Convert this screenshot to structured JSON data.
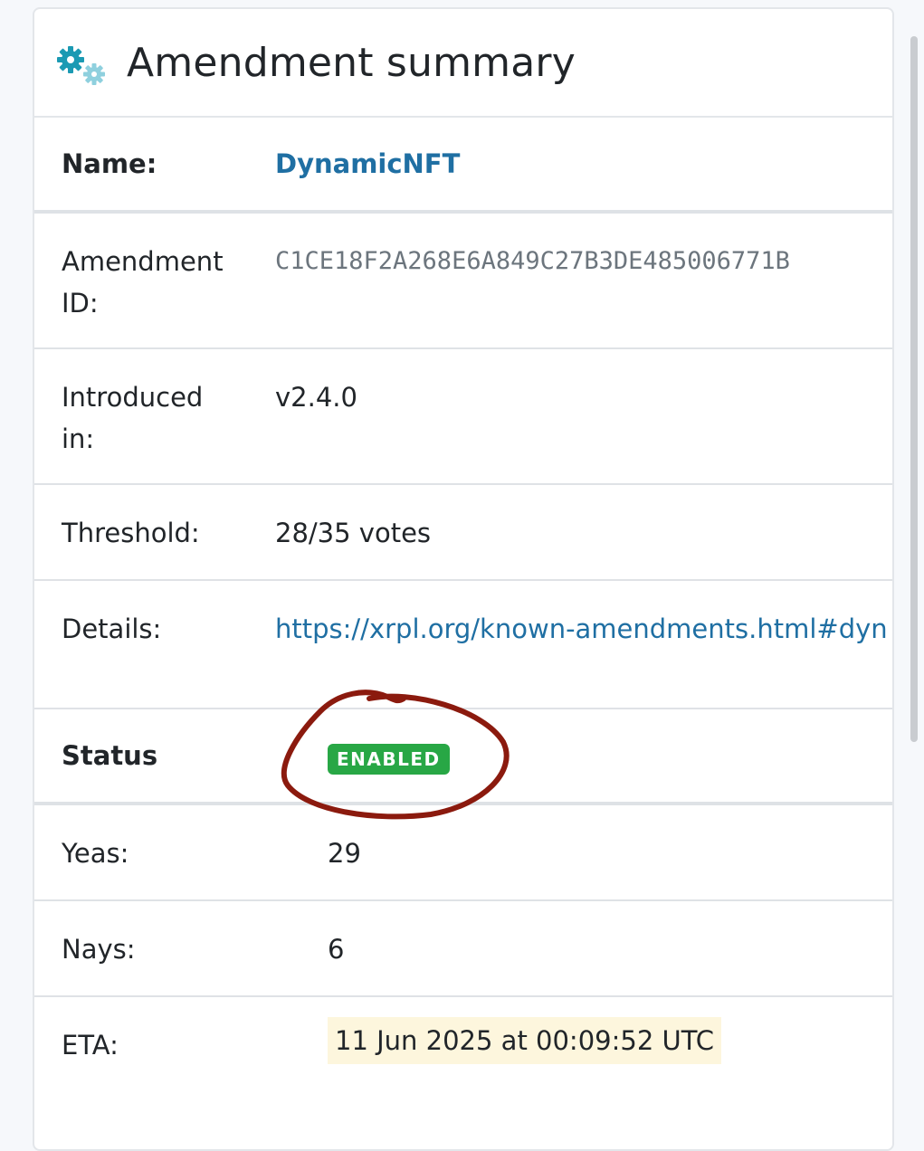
{
  "header": {
    "title": "Amendment summary",
    "icon": "gears-icon",
    "icon_color": "#1b9ab3"
  },
  "rows": {
    "name": {
      "label": "Name:",
      "value": "DynamicNFT"
    },
    "amendment_id": {
      "label_line1": "Amendment",
      "label_line2": "ID:",
      "value": "C1CE18F2A268E6A849C27B3DE485006771B"
    },
    "introduced": {
      "label_line1": "Introduced",
      "label_line2": "in:",
      "value": "v2.4.0"
    },
    "threshold": {
      "label": "Threshold:",
      "value": "28/35 votes"
    },
    "details": {
      "label": "Details:",
      "value": "https://xrpl.org/known-amendments.html#dyn"
    },
    "status": {
      "label": "Status",
      "value": "ENABLED",
      "color": "#28a745"
    },
    "yeas": {
      "label": "Yeas:",
      "value": "29"
    },
    "nays": {
      "label": "Nays:",
      "value": "6"
    },
    "eta": {
      "label": "ETA:",
      "value": "11 Jun 2025 at 00:09:52 UTC"
    }
  },
  "annotation": {
    "color": "#8b1a0e"
  }
}
